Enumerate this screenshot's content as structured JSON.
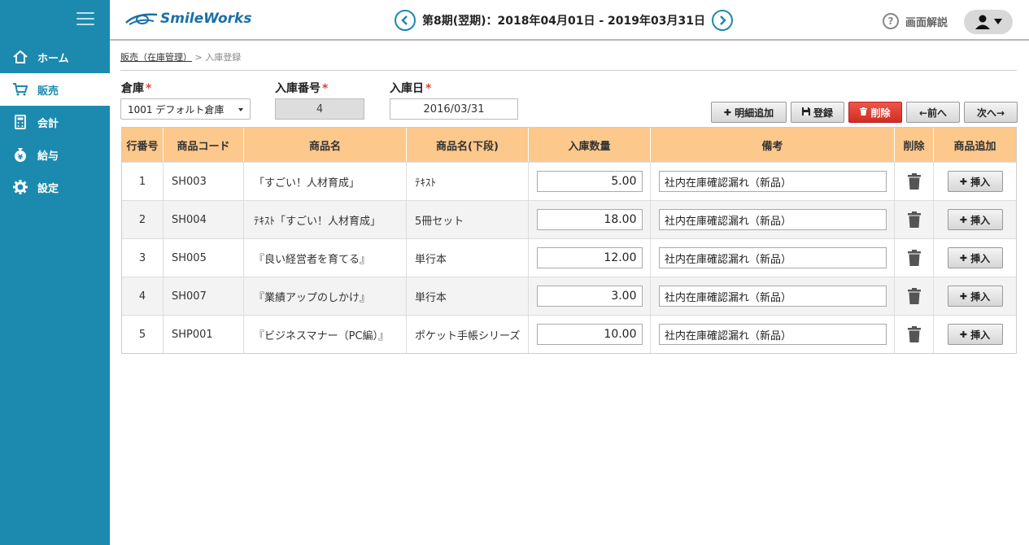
{
  "app": {
    "logo_text": "SmileWorks"
  },
  "header": {
    "period": "第8期(翌期)：2018年04月01日 - 2019年03月31日",
    "help_label": "画面解説"
  },
  "sidebar": {
    "items": [
      {
        "label": "ホーム",
        "icon": "home-icon"
      },
      {
        "label": "販売",
        "icon": "cart-icon",
        "active": true
      },
      {
        "label": "会計",
        "icon": "calculator-icon"
      },
      {
        "label": "給与",
        "icon": "money-bag-icon"
      },
      {
        "label": "設定",
        "icon": "gear-icon"
      }
    ]
  },
  "breadcrumb": {
    "parent": "販売（在庫管理）",
    "separator": ">",
    "current": "入庫登録"
  },
  "form": {
    "warehouse_label": "倉庫",
    "warehouse_value": "1001 デフォルト倉庫",
    "number_label": "入庫番号",
    "number_value": "4",
    "date_label": "入庫日",
    "date_value": "2016/03/31",
    "required_mark": "*"
  },
  "toolbar": {
    "add_detail": "明細追加",
    "register": "登録",
    "delete": "削除",
    "prev": "←前へ",
    "next": "次へ→"
  },
  "table": {
    "columns": [
      "行番号",
      "商品コード",
      "商品名",
      "商品名(下段)",
      "入庫数量",
      "備考",
      "削除",
      "商品追加"
    ],
    "insert_label": "挿入",
    "rows": [
      {
        "no": "1",
        "code": "SH003",
        "name": "「すごい！人材育成」",
        "name2": "ﾃｷｽﾄ",
        "qty": "5.00",
        "note": "社内在庫確認漏れ（新品）"
      },
      {
        "no": "2",
        "code": "SH004",
        "name": "ﾃｷｽﾄ「すごい！人材育成」",
        "name2": "5冊セット",
        "qty": "18.00",
        "note": "社内在庫確認漏れ（新品）"
      },
      {
        "no": "3",
        "code": "SH005",
        "name": "『良い経営者を育てる』",
        "name2": "単行本",
        "qty": "12.00",
        "note": "社内在庫確認漏れ（新品）"
      },
      {
        "no": "4",
        "code": "SH007",
        "name": "『業績アップのしかけ』",
        "name2": "単行本",
        "qty": "3.00",
        "note": "社内在庫確認漏れ（新品）"
      },
      {
        "no": "5",
        "code": "SHP001",
        "name": "『ビジネスマナー（PC編）』",
        "name2": "ポケット手帳シリーズ",
        "qty": "10.00",
        "note": "社内在庫確認漏れ（新品）"
      }
    ]
  },
  "colors": {
    "sidebar": "#1b8aae",
    "table_header": "#fcc88c",
    "danger": "#d22d22"
  }
}
